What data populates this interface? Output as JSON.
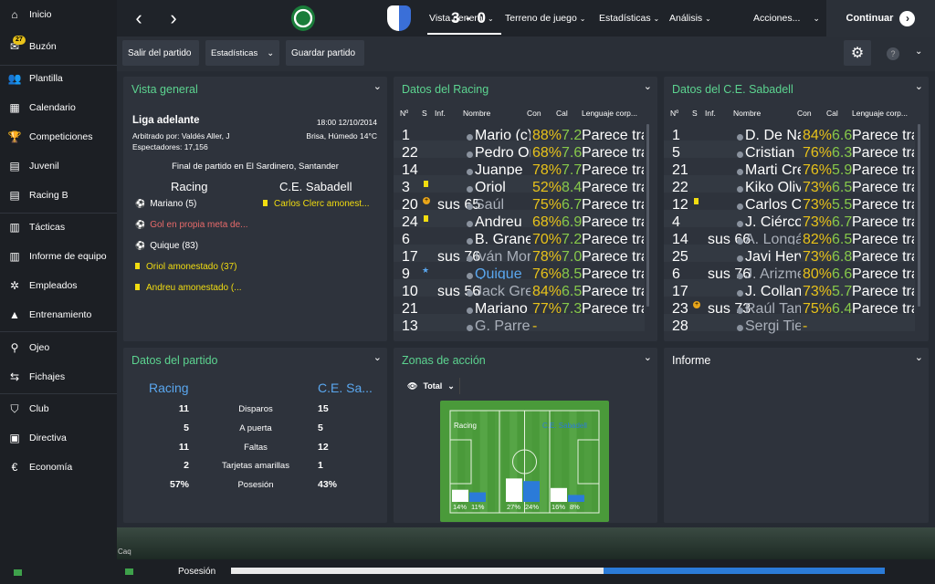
{
  "nav": {
    "items": [
      {
        "label": "Inicio",
        "icon": "home-icon"
      },
      {
        "label": "Buzón",
        "icon": "inbox-icon",
        "badge": "27"
      },
      {
        "label": "Plantilla",
        "icon": "squad-icon"
      },
      {
        "label": "Calendario",
        "icon": "calendar-icon"
      },
      {
        "label": "Competiciones",
        "icon": "trophy-icon"
      },
      {
        "label": "Juvenil",
        "icon": "youth-icon"
      },
      {
        "label": "Racing B",
        "icon": "reserve-icon"
      },
      {
        "label": "Tácticas",
        "icon": "tactics-icon"
      },
      {
        "label": "Informe de equipo",
        "icon": "report-icon"
      },
      {
        "label": "Empleados",
        "icon": "staff-icon"
      },
      {
        "label": "Entrenamiento",
        "icon": "training-icon"
      },
      {
        "label": "Ojeo",
        "icon": "search-icon"
      },
      {
        "label": "Fichajes",
        "icon": "transfers-icon"
      },
      {
        "label": "Club",
        "icon": "club-icon"
      },
      {
        "label": "Directiva",
        "icon": "briefcase-icon"
      },
      {
        "label": "Economía",
        "icon": "finance-icon"
      }
    ]
  },
  "top": {
    "score": "3 - 0",
    "tabs": [
      "Vista general",
      "Terreno de juego",
      "Estadísticas",
      "Análisis"
    ],
    "actions": "Acciones...",
    "continue": "Continuar"
  },
  "sub": {
    "exit": "Salir del partido",
    "stats": "Estadísticas",
    "save": "Guardar partido"
  },
  "overview": {
    "title": "Vista general",
    "competition": "Liga adelante",
    "datetime": "18:00 12/10/2014",
    "referee": "Arbitrado por: Valdés Aller, J",
    "weather": "Brisa, Húmedo 14°C",
    "spectators": "Espectadores: 17,156",
    "result_text": "Final de partido en El Sardinero, Santander",
    "home": "Racing",
    "away": "C.E. Sabadell",
    "home_events": [
      {
        "icon": "ball-icon",
        "text": "Mariano (5)",
        "color": "#ffffff"
      },
      {
        "icon": "own-goal-icon",
        "text": "Gol en propia meta de...",
        "color": "#e86a6a"
      },
      {
        "icon": "ball-icon",
        "text": "Quique (83)",
        "color": "#ffffff"
      },
      {
        "icon": "yellow-card-icon",
        "text": "Oriol amonestado (37)",
        "color": "#f2dd10"
      },
      {
        "icon": "yellow-card-icon",
        "text": "Andreu amonestado (...",
        "color": "#f2dd10"
      }
    ],
    "away_events": [
      {
        "icon": "yellow-card-icon",
        "text": "Carlos Clerc amonest...",
        "color": "#f2dd10"
      }
    ]
  },
  "headers": {
    "num": "Nº",
    "s": "S",
    "inf": "Inf.",
    "name": "Nombre",
    "con": "Con",
    "cal": "Cal",
    "body": "Lenguaje corp..."
  },
  "racing": {
    "title": "Datos del Racing",
    "rows": [
      {
        "num": "1",
        "s": "",
        "inf": "",
        "name": "Mario (c)",
        "con": "88%",
        "cal": "7.2",
        "body": "Parece tranquilo",
        "dim": false
      },
      {
        "num": "22",
        "s": "",
        "inf": "",
        "name": "Pedro Orfila",
        "con": "68%",
        "cal": "7.6",
        "body": "Parece tranquilo",
        "dim": false
      },
      {
        "num": "14",
        "s": "",
        "inf": "",
        "name": "Juanpe",
        "con": "78%",
        "cal": "7.7",
        "body": "Parece tranquilo",
        "dim": false
      },
      {
        "num": "3",
        "s": "yellow",
        "inf": "",
        "name": "Oriol",
        "con": "52%",
        "cal": "8.4",
        "body": "Parece tranquilo",
        "dim": false
      },
      {
        "num": "20",
        "s": "orange",
        "inf": "sus 65",
        "name": "Saúl",
        "con": "75%",
        "cal": "6.7",
        "body": "Parece tranquilo",
        "dim": true
      },
      {
        "num": "24",
        "s": "yellow",
        "inf": "",
        "name": "Andreu",
        "con": "68%",
        "cal": "6.9",
        "body": "Parece tranquilo",
        "dim": false
      },
      {
        "num": "6",
        "s": "",
        "inf": "",
        "name": "B. Granero",
        "con": "70%",
        "cal": "7.2",
        "body": "Parece tranquilo",
        "dim": false
      },
      {
        "num": "17",
        "s": "",
        "inf": "sus 76",
        "name": "Iván Moreno",
        "con": "78%",
        "cal": "7.0",
        "body": "Parece tranquilo",
        "dim": true
      },
      {
        "num": "9",
        "s": "star",
        "inf": "",
        "name": "Quique",
        "con": "76%",
        "cal": "8.5",
        "body": "Parece tranquilo",
        "dim": false,
        "blue": true
      },
      {
        "num": "10",
        "s": "",
        "inf": "sus 56",
        "name": "Jack Grealish",
        "con": "84%",
        "cal": "6.5",
        "body": "Parece tranquilo",
        "dim": true
      },
      {
        "num": "21",
        "s": "",
        "inf": "",
        "name": "Mariano",
        "con": "77%",
        "cal": "7.3",
        "body": "Parece tranquilo",
        "dim": false
      },
      {
        "num": "13",
        "s": "",
        "inf": "",
        "name": "G. Parreño",
        "con": "-",
        "cal": "",
        "body": "",
        "dim": true
      }
    ]
  },
  "sabadell": {
    "title": "Datos del C.E. Sabadell",
    "rows": [
      {
        "num": "1",
        "s": "",
        "inf": "",
        "name": "D. De Navas",
        "con": "84%",
        "cal": "6.6",
        "body": "Parece tranquilo",
        "dim": false
      },
      {
        "num": "5",
        "s": "",
        "inf": "",
        "name": "Cristian",
        "con": "76%",
        "cal": "6.3",
        "body": "Parece tranquilo",
        "dim": false
      },
      {
        "num": "21",
        "s": "",
        "inf": "",
        "name": "Marti Crespi",
        "con": "76%",
        "cal": "5.9",
        "body": "Parece tranquilo",
        "dim": false
      },
      {
        "num": "22",
        "s": "",
        "inf": "",
        "name": "Kiko Olivas",
        "con": "73%",
        "cal": "6.5",
        "body": "Parece tranquilo",
        "dim": false
      },
      {
        "num": "12",
        "s": "yellow",
        "inf": "",
        "name": "Carlos Clerc",
        "con": "73%",
        "cal": "5.5",
        "body": "Parece tranquilo",
        "dim": false
      },
      {
        "num": "4",
        "s": "",
        "inf": "",
        "name": "J. Ciércoles",
        "con": "73%",
        "cal": "6.7",
        "body": "Parece tranquilo",
        "dim": false
      },
      {
        "num": "14",
        "s": "",
        "inf": "sus 66",
        "name": "A. Longás",
        "con": "82%",
        "cal": "6.5",
        "body": "Parece tranquilo",
        "dim": true
      },
      {
        "num": "25",
        "s": "",
        "inf": "",
        "name": "Javi Hervás",
        "con": "73%",
        "cal": "6.8",
        "body": "Parece tranquilo",
        "dim": false
      },
      {
        "num": "6",
        "s": "",
        "inf": "sus 76",
        "name": "J. Arizmendi",
        "con": "80%",
        "cal": "6.6",
        "body": "Parece tranquilo",
        "dim": true
      },
      {
        "num": "17",
        "s": "",
        "inf": "",
        "name": "J. Collantes",
        "con": "73%",
        "cal": "5.7",
        "body": "Parece tranquilo",
        "dim": false
      },
      {
        "num": "23",
        "s": "orange",
        "inf": "sus 73",
        "name": "Raúl Tamudo",
        "con": "75%",
        "cal": "6.4",
        "body": "Parece tranquilo",
        "dim": true
      },
      {
        "num": "28",
        "s": "",
        "inf": "",
        "name": "Sergi Tienda",
        "con": "-",
        "cal": "",
        "body": "",
        "dim": true
      }
    ]
  },
  "match_stats": {
    "title": "Datos del partido",
    "home": "Racing",
    "away": "C.E. Sa...",
    "rows": [
      {
        "h": "11",
        "label": "Disparos",
        "a": "15"
      },
      {
        "h": "5",
        "label": "A puerta",
        "a": "5"
      },
      {
        "h": "11",
        "label": "Faltas",
        "a": "12"
      },
      {
        "h": "2",
        "label": "Tarjetas amarillas",
        "a": "1"
      },
      {
        "h": "57%",
        "label": "Posesión",
        "a": "43%"
      }
    ]
  },
  "action_zones": {
    "title": "Zonas de acción",
    "filter": "Total",
    "home_label": "Racing",
    "away_label": "C.E. Sabadell",
    "zones": [
      {
        "home": 14,
        "away": 11,
        "home_label": "14%",
        "away_label": "11%"
      },
      {
        "home": 27,
        "away": 24,
        "home_label": "27%",
        "away_label": "24%"
      },
      {
        "home": 16,
        "away": 8,
        "home_label": "16%",
        "away_label": "8%"
      }
    ]
  },
  "informe": {
    "title": "Informe"
  },
  "bottom": {
    "possession_label": "Posesión",
    "possession_home": 57,
    "possession_away": 43,
    "footer_tag": "Caq"
  },
  "colors": {
    "accent": "#5cd490",
    "home_blue": "#5aa7ef",
    "yellow": "#f2dd10",
    "rating_green": "#86c84a"
  }
}
